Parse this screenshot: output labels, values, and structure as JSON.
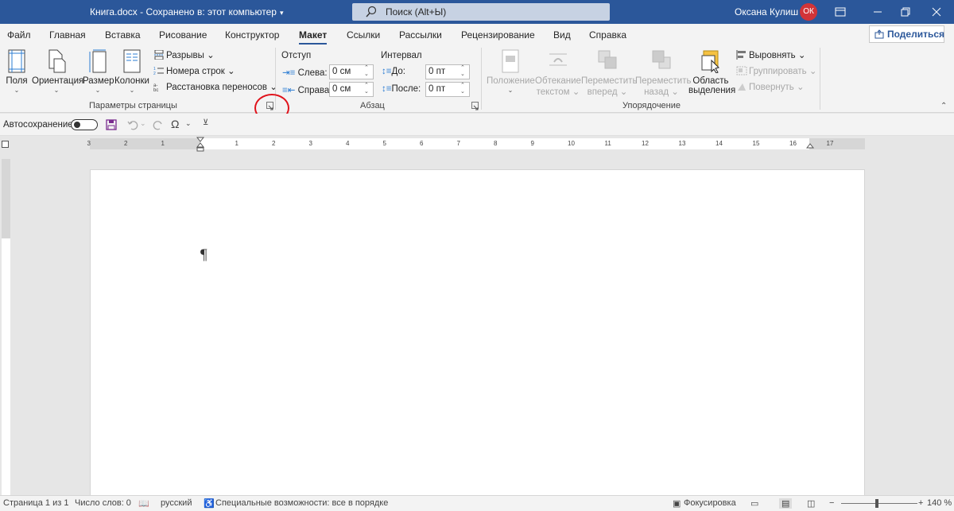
{
  "titlebar": {
    "doc_title": "Книга.docx  -  Сохранено в: этот компьютер",
    "search_placeholder": "Поиск (Alt+Ы)",
    "user_name": "Оксана Кулиш",
    "avatar_initials": "ОК"
  },
  "tabs": [
    "Файл",
    "Главная",
    "Вставка",
    "Рисование",
    "Конструктор",
    "Макет",
    "Ссылки",
    "Рассылки",
    "Рецензирование",
    "Вид",
    "Справка"
  ],
  "active_tab": "Макет",
  "share_label": "Поделиться",
  "ribbon": {
    "page_setup": {
      "margins": "Поля",
      "orientation": "Ориентация",
      "size": "Размер",
      "columns": "Колонки",
      "breaks": "Разрывы",
      "line_numbers": "Номера строк",
      "hyphenation": "Расстановка переносов",
      "group_label": "Параметры страницы"
    },
    "paragraph": {
      "indent_header": "Отступ",
      "spacing_header": "Интервал",
      "left_label": "Слева:",
      "left_value": "0 см",
      "right_label": "Справа:",
      "right_value": "0 см",
      "before_label": "До:",
      "before_value": "0 пт",
      "after_label": "После:",
      "after_value": "0 пт",
      "group_label": "Абзац"
    },
    "arrange": {
      "position": "Положение",
      "wrap_text_1": "Обтекание",
      "wrap_text_2": "текстом",
      "bring_forward_1": "Переместить",
      "bring_forward_2": "вперед",
      "send_backward_1": "Переместить",
      "send_backward_2": "назад",
      "selection_pane_1": "Область",
      "selection_pane_2": "выделения",
      "align": "Выровнять",
      "group": "Группировать",
      "rotate": "Повернуть",
      "group_label": "Упорядочение"
    }
  },
  "qat": {
    "autosave": "Автосохранение"
  },
  "ruler_numbers": [
    "3",
    "2",
    "1",
    "1",
    "2",
    "3",
    "4",
    "5",
    "6",
    "7",
    "8",
    "9",
    "10",
    "11",
    "12",
    "13",
    "14",
    "15",
    "16",
    "17"
  ],
  "document": {
    "pilcrow": "¶"
  },
  "status": {
    "page": "Страница 1 из 1",
    "words": "Число слов: 0",
    "language": "русский",
    "accessibility": "Специальные возможности: все в порядке",
    "focus": "Фокусировка",
    "zoom": "140 %"
  },
  "colors": {
    "titlebar": "#2b579a",
    "accent": "#2b579a",
    "highlight_circle": "#e0121b",
    "avatar": "#d13438"
  }
}
